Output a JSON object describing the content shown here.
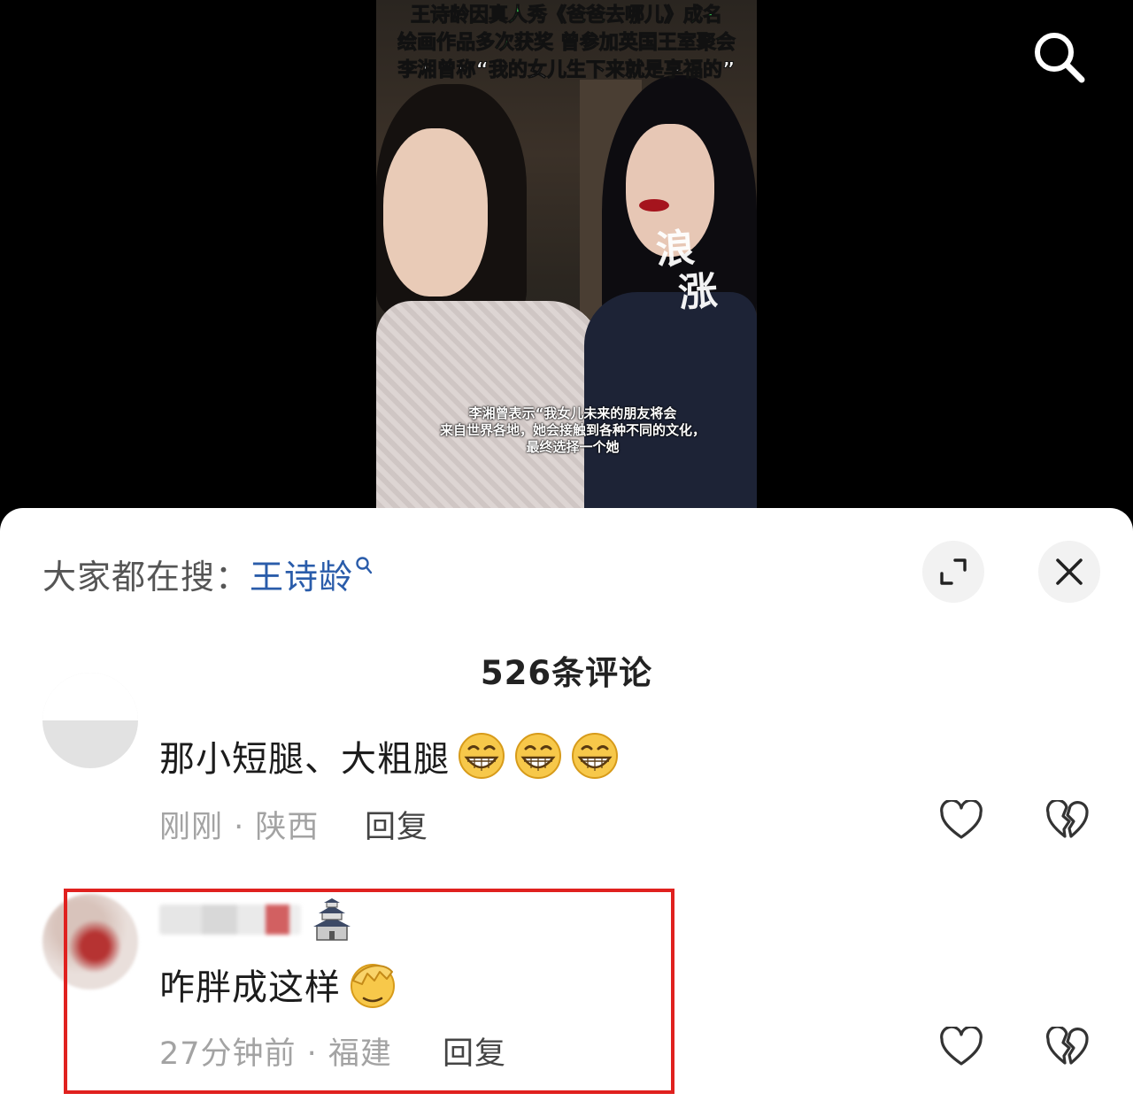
{
  "video": {
    "caption_lines": [
      "王诗龄因真人秀《爸爸去哪儿》成名",
      "绘画作品多次获奖 曾参加英国王室聚会",
      "李湘曾称“我的女儿生下来就是享福的”"
    ],
    "subtitle_lines": [
      "李湘曾表示“我女儿未来的朋友将会",
      "来自世界各地，她会接触到各种不同的文化，",
      "最终选择一个她"
    ],
    "watermark_chars": [
      "浪",
      "涨"
    ]
  },
  "header": {
    "trend_prefix": "大家都在搜：",
    "trend_term": "王诗龄"
  },
  "comments_count_label": "526条评论",
  "comments": [
    {
      "text": "那小短腿、大粗腿",
      "emojis": [
        "grin-emoji",
        "grin-emoji",
        "grin-emoji"
      ],
      "meta": "刚刚 · 陕西",
      "reply_label": "回复"
    },
    {
      "text": "咋胖成这样",
      "emojis": [
        "facepalm-emoji"
      ],
      "meta": "27分钟前 · 福建",
      "reply_label": "回复",
      "highlighted": true
    }
  ],
  "colors": {
    "trend_term": "#2a5caa",
    "highlight_border": "#e0211f",
    "caption_green": "#3be05a"
  }
}
